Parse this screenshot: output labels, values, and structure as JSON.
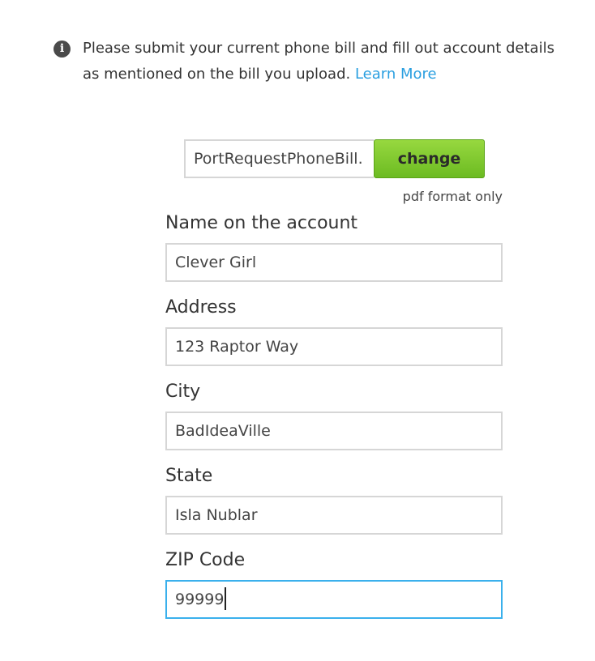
{
  "notice": {
    "icon": "info-icon",
    "text": "Please submit your current phone bill and fill out account details as mentioned on the bill you upload.",
    "link_label": "Learn More",
    "link_color": "#2a9fe0"
  },
  "upload": {
    "file_name": "PortRequestPhoneBill.",
    "change_label": "change",
    "format_note": "pdf format only",
    "button_color": "#7ec82c"
  },
  "form": {
    "fields": [
      {
        "label": "Name on the account",
        "value": "Clever Girl"
      },
      {
        "label": "Address",
        "value": "123 Raptor Way"
      },
      {
        "label": "City",
        "value": "BadIdeaVille"
      },
      {
        "label": "State",
        "value": "Isla Nublar"
      },
      {
        "label": "ZIP Code",
        "value": "99999",
        "focused": true
      }
    ],
    "focus_color": "#3ab0ec"
  }
}
